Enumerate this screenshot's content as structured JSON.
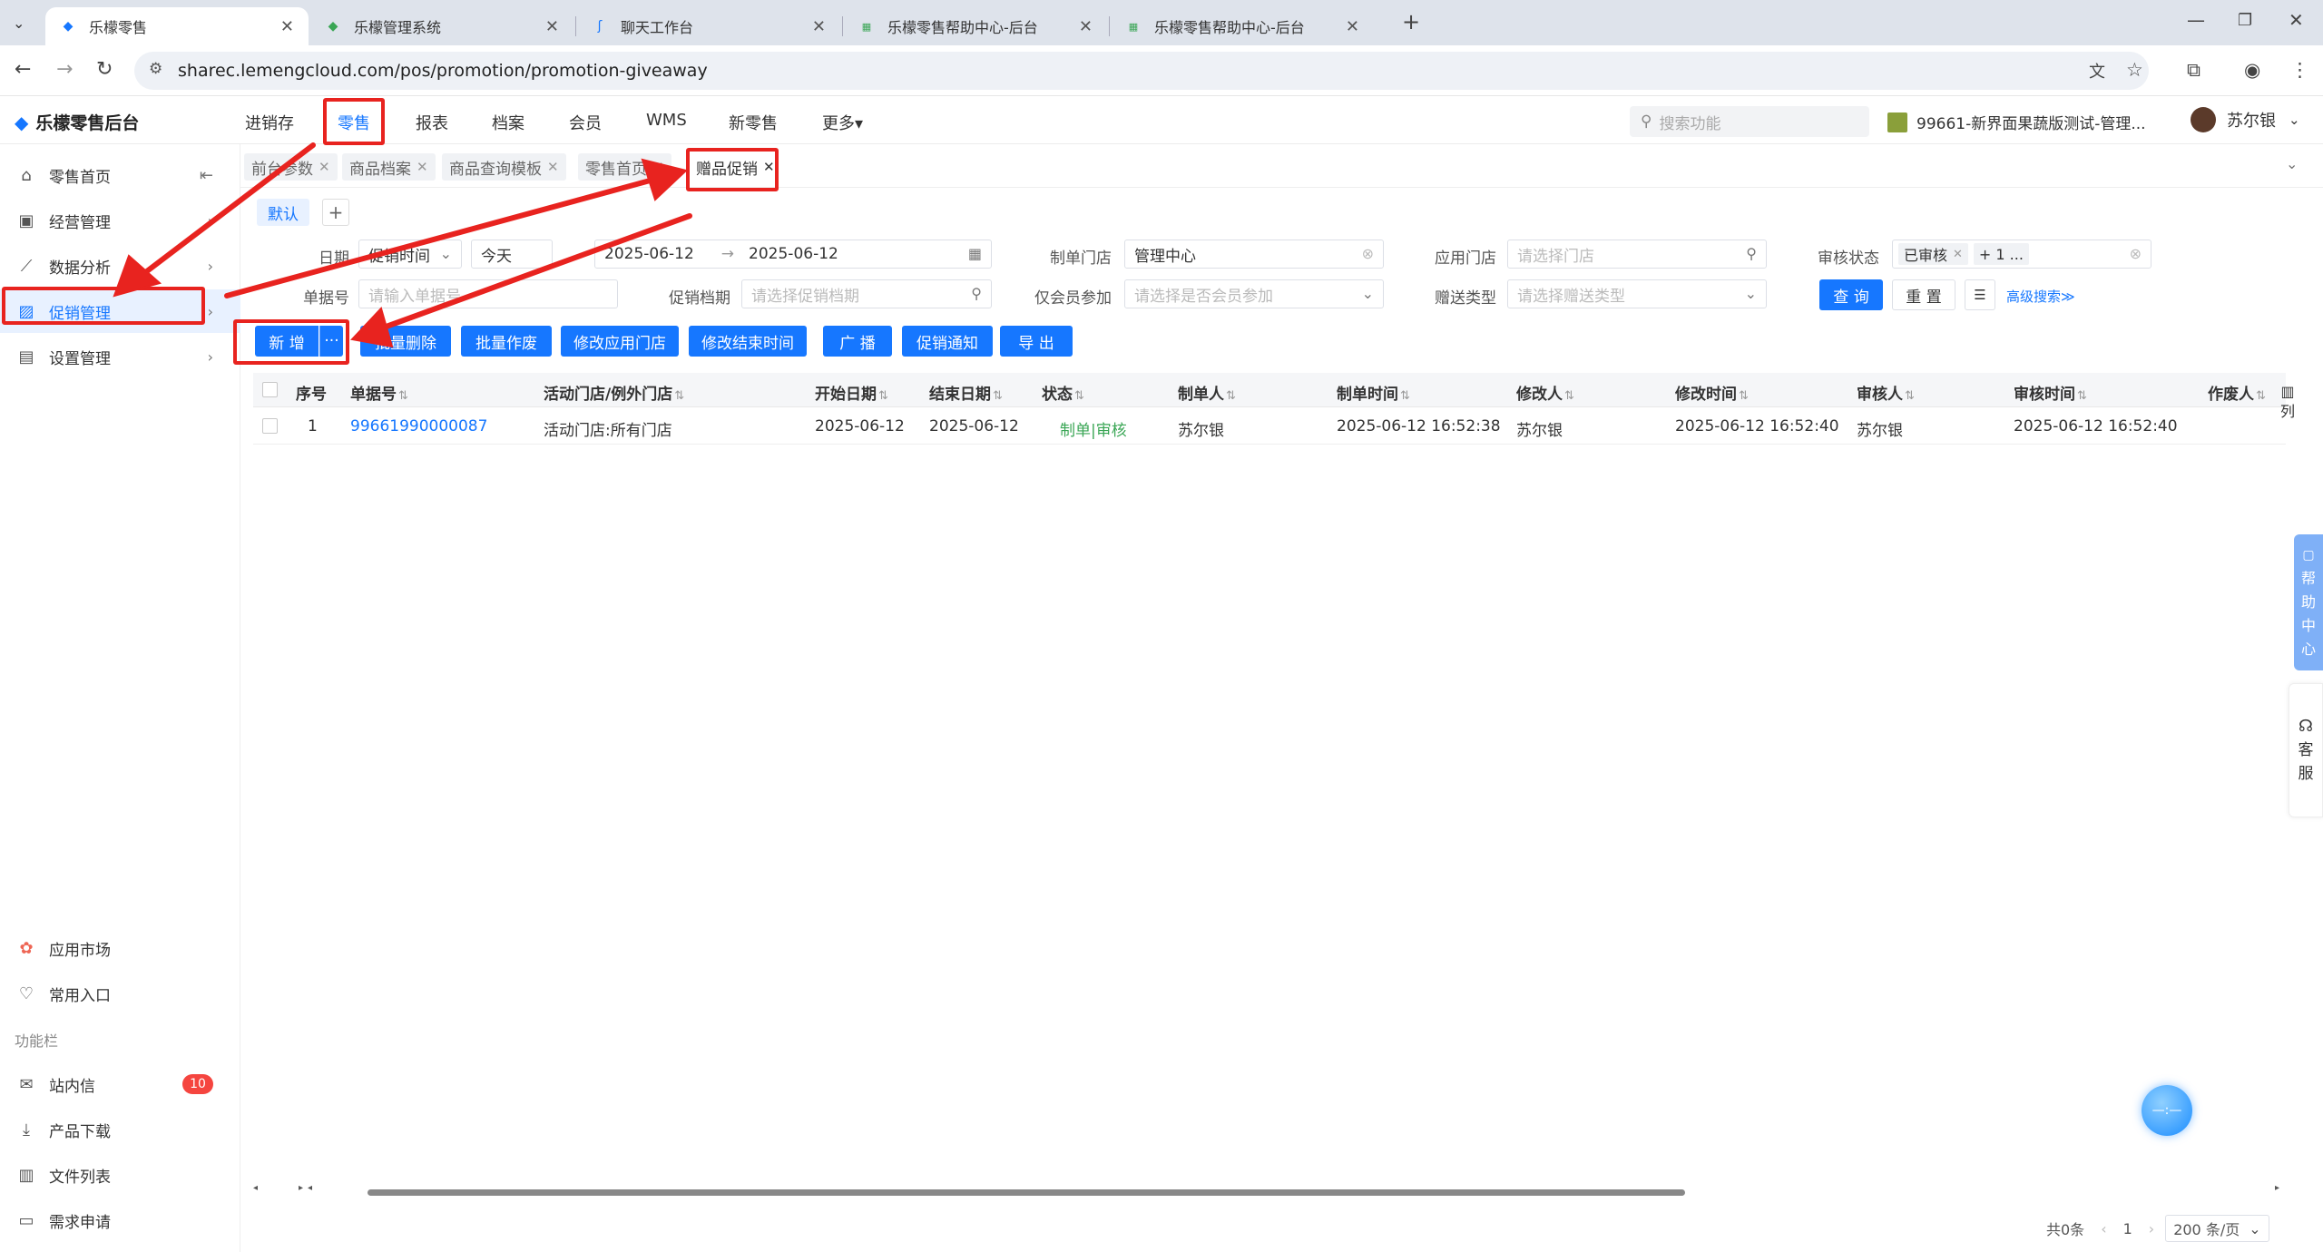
{
  "browser": {
    "tabs": [
      {
        "title": "乐檬零售",
        "active": true
      },
      {
        "title": "乐檬管理系统",
        "active": false
      },
      {
        "title": "聊天工作台",
        "active": false
      },
      {
        "title": "乐檬零售帮助中心-后台",
        "active": false
      },
      {
        "title": "乐檬零售帮助中心-后台",
        "active": false
      }
    ],
    "url": "sharec.lemengcloud.com/pos/promotion/promotion-giveaway"
  },
  "header": {
    "logo": "乐檬零售后台",
    "nav": [
      {
        "label": "进销存",
        "active": false
      },
      {
        "label": "零售",
        "active": true
      },
      {
        "label": "报表",
        "active": false
      },
      {
        "label": "档案",
        "active": false
      },
      {
        "label": "会员",
        "active": false
      },
      {
        "label": "WMS",
        "active": false
      },
      {
        "label": "新零售",
        "active": false
      },
      {
        "label": "更多▾",
        "active": false
      }
    ],
    "search_placeholder": "搜索功能",
    "store": "99661-新界面果蔬版测试-管理...",
    "user": "苏尔银"
  },
  "sidebar": {
    "items": [
      {
        "label": "零售首页",
        "icon": "home-icon"
      },
      {
        "label": "经营管理",
        "icon": "chart-board-icon"
      },
      {
        "label": "数据分析",
        "icon": "line-chart-icon"
      },
      {
        "label": "促销管理",
        "icon": "promo-icon",
        "active": true
      },
      {
        "label": "设置管理",
        "icon": "settings-icon"
      }
    ],
    "bottom": [
      {
        "label": "应用市场",
        "icon": "app-market-icon"
      },
      {
        "label": "常用入口",
        "icon": "heart-icon"
      }
    ],
    "func_label": "功能栏",
    "func_items": [
      {
        "label": "站内信",
        "icon": "mail-icon",
        "badge": "10"
      },
      {
        "label": "产品下载",
        "icon": "download-icon"
      },
      {
        "label": "文件列表",
        "icon": "file-list-icon"
      },
      {
        "label": "需求申请",
        "icon": "request-icon"
      }
    ]
  },
  "page_tabs": [
    {
      "label": "前台参数"
    },
    {
      "label": "商品档案"
    },
    {
      "label": "商品查询模板"
    },
    {
      "label": "零售首页"
    },
    {
      "label": "赠品促销",
      "active": true
    }
  ],
  "view": {
    "default": "默认",
    "add": "+"
  },
  "filters": {
    "date_label": "日期",
    "date_type": "促销时间",
    "date_quick": "今天",
    "date_start": "2025-06-12",
    "date_end": "2025-06-12",
    "maker_store_label": "制单门店",
    "maker_store_value": "管理中心",
    "apply_store_label": "应用门店",
    "apply_store_placeholder": "请选择门店",
    "audit_label": "审核状态",
    "audit_tag": "已审核",
    "audit_more": "+ 1 ...",
    "bill_label": "单据号",
    "bill_placeholder": "请输入单据号",
    "promo_label": "促销档期",
    "promo_placeholder": "请选择促销档期",
    "member_label": "仅会员参加",
    "member_placeholder": "请选择是否会员参加",
    "gift_label": "赠送类型",
    "gift_placeholder": "请选择赠送类型",
    "query": "查 询",
    "reset": "重 置",
    "advanced": "高级搜索≫"
  },
  "toolbar": {
    "add": "新 增",
    "more": "···",
    "batch_delete": "批量删除",
    "batch_void": "批量作废",
    "edit_store": "修改应用门店",
    "edit_end": "修改结束时间",
    "broadcast": "广 播",
    "notify": "促销通知",
    "export": "导 出"
  },
  "table": {
    "columns": [
      "序号",
      "单据号",
      "活动门店/例外门店",
      "开始日期",
      "结束日期",
      "状态",
      "制单人",
      "制单时间",
      "修改人",
      "修改时间",
      "审核人",
      "审核时间",
      "作废人"
    ],
    "sortable": [
      false,
      true,
      true,
      true,
      true,
      true,
      true,
      true,
      true,
      true,
      true,
      true,
      true
    ],
    "rows": [
      {
        "seq": "1",
        "bill": "99661990000087",
        "store": "活动门店:所有门店",
        "start": "2025-06-12",
        "end": "2025-06-12",
        "status": "制单|审核",
        "maker": "苏尔银",
        "make_time": "2025-06-12 16:52:38",
        "modifier": "苏尔银",
        "modify_time": "2025-06-12 16:52:40",
        "auditor": "苏尔银",
        "audit_time": "2025-06-12 16:52:40",
        "voider": ""
      }
    ],
    "col_setting": "列"
  },
  "pager": {
    "total": "共0条",
    "page": "1",
    "size": "200 条/页"
  },
  "float": {
    "help": [
      "帮",
      "助",
      "中",
      "心"
    ],
    "service": [
      "客",
      "服"
    ],
    "bubble": "—:—"
  },
  "colors": {
    "accent": "#1677ff",
    "annotation": "#e8231f",
    "status_green": "#3aa655"
  }
}
